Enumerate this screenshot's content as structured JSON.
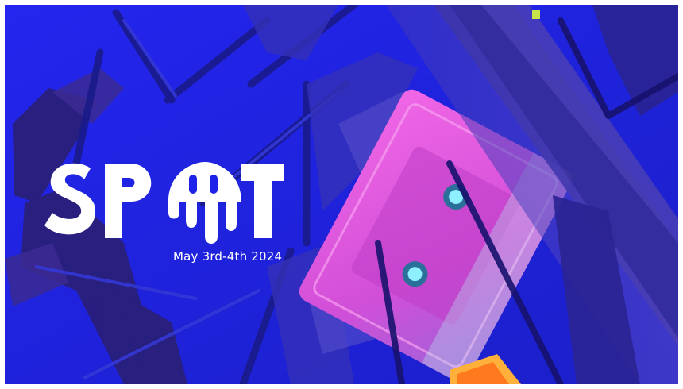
{
  "banner": {
    "logo_text": "SPOT",
    "date_text": "May 3rd-4th 2024"
  },
  "colors": {
    "background": "#1f22e8",
    "cassette": "#e155d9",
    "logo": "#ffffff",
    "shadow": "#1a1560"
  },
  "icons": {
    "cassette": "cassette-tape-icon",
    "logo_drip": "paint-drip-icon"
  }
}
